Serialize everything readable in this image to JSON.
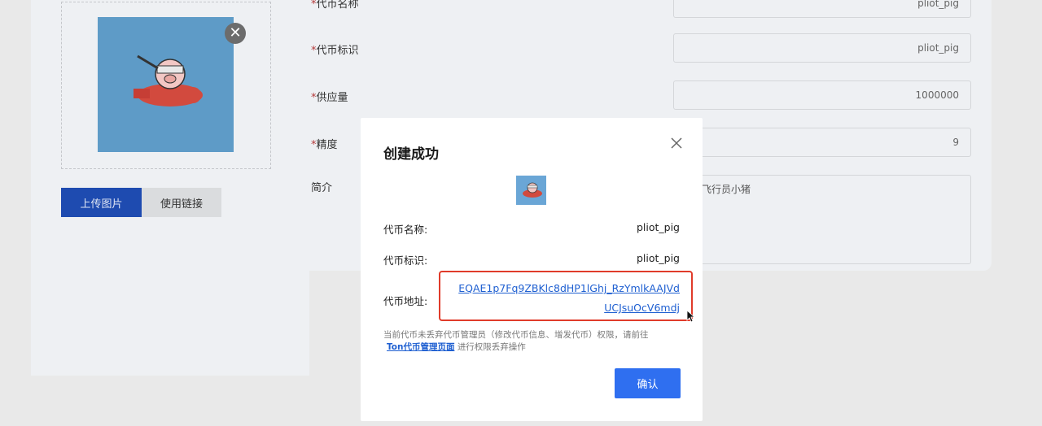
{
  "background": {
    "upload_button": "上传图片",
    "link_button": "使用链接",
    "form": {
      "fields": [
        {
          "label": "代币名称",
          "required": true,
          "value": "pliot_pig"
        },
        {
          "label": "代币标识",
          "required": true,
          "value": "pliot_pig"
        },
        {
          "label": "供应量",
          "required": true,
          "value": "1000000"
        },
        {
          "label": "精度",
          "required": true,
          "value": "9"
        }
      ],
      "intro_label": "简介",
      "intro_value": "飞行员小猪"
    }
  },
  "modal": {
    "title": "创建成功",
    "rows": [
      {
        "label": "代币名称:",
        "value": "pliot_pig"
      },
      {
        "label": "代币标识:",
        "value": "pliot_pig"
      }
    ],
    "address_label": "代币地址:",
    "address": "EQAE1p7Fq9ZBKlc8dHP1lGhj_RzYmlkAAJVdUCJsuOcV6mdj",
    "notice_text": "当前代币未丢弃代币管理员（修改代币信息、增发代币）权限，请前往",
    "notice_link": "Ton代币管理页面",
    "notice_tail": "进行权限丢弃操作",
    "confirm_label": "确认"
  },
  "colors": {
    "primary": "#2f6ff0",
    "link": "#1e5fd1",
    "highlight": "#e03b2a"
  },
  "icons": {
    "close": "close-icon",
    "remove": "remove-image-icon",
    "cursor": "mouse-pointer-icon"
  }
}
